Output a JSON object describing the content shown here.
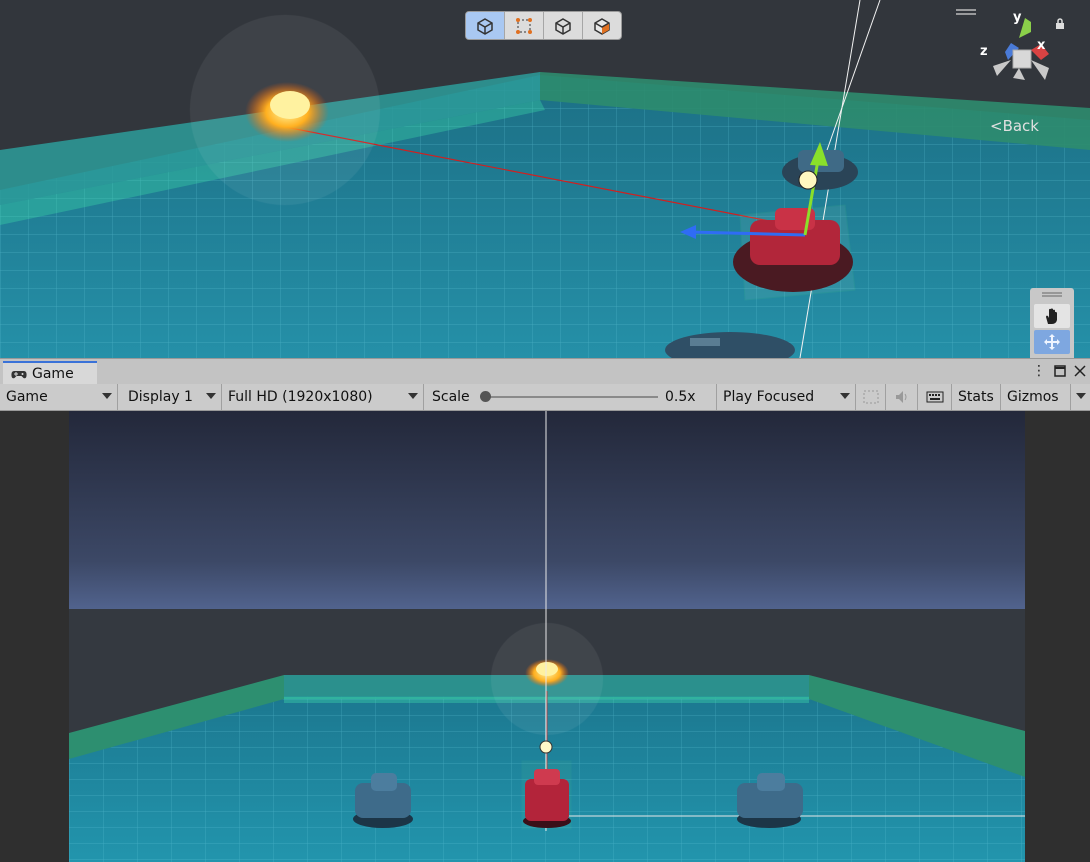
{
  "scene_view": {
    "toolbar_icons": [
      "cube-icon",
      "rect-transform-icon",
      "wire-cube-icon",
      "shaded-cube-icon"
    ],
    "gizmo_axes": {
      "y": "y",
      "x": "x",
      "z": "z"
    },
    "back_label": "Back",
    "tool_icons": [
      "hand-icon",
      "move-icon"
    ]
  },
  "game_panel": {
    "tab_label": "Game",
    "toolbar": {
      "view_select": "Game",
      "display_select": "Display 1",
      "resolution_select": "Full HD (1920x1080)",
      "scale_label": "Scale",
      "scale_value": "0.5x",
      "scale_level": 0.0,
      "play_mode_select": "Play Focused",
      "stats_label": "Stats",
      "gizmos_label": "Gizmos"
    }
  },
  "colors": {
    "ground": "#1f7f95",
    "wall": "#2aa090",
    "sky_top": "#23283a",
    "sky_horizon": "#4d5f8a",
    "accent": "#3a72d8"
  }
}
